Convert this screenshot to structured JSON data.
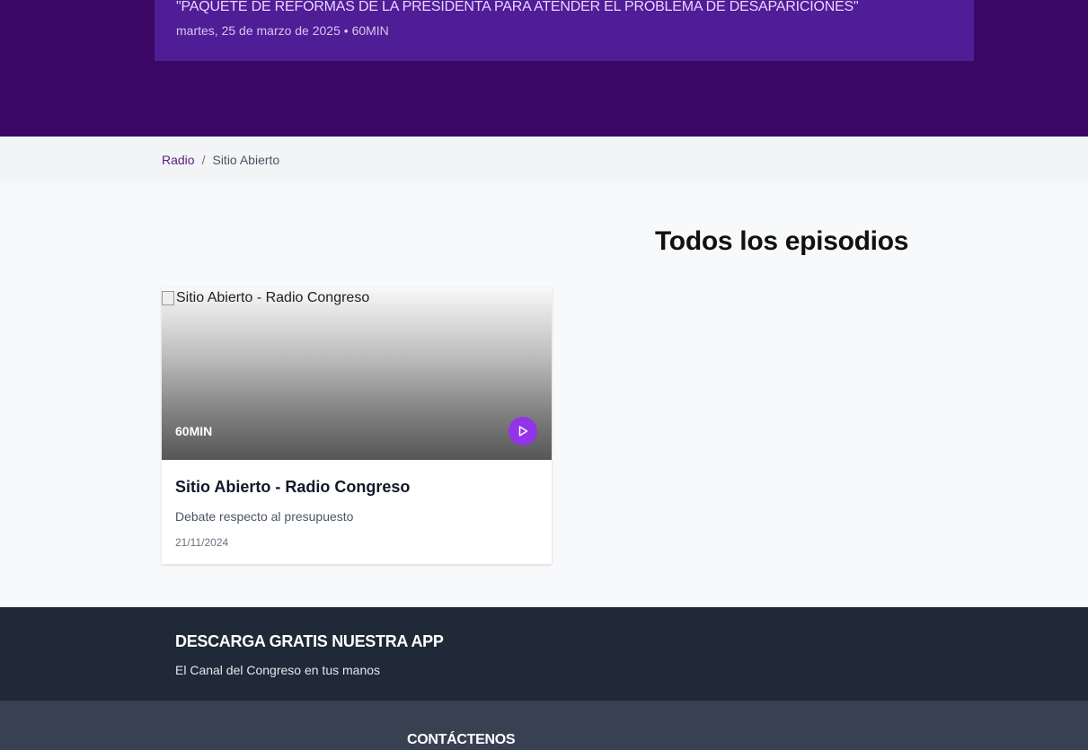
{
  "hero": {
    "title": "\"PAQUETE DE REFORMAS DE LA PRESIDENTA PARA ATENDER EL PROBLEMA DE DESAPARICIONES\"",
    "meta": "martes, 25 de marzo de 2025 • 60MIN"
  },
  "breadcrumb": {
    "items": [
      "Radio",
      "Sitio Abierto"
    ],
    "separator": "/"
  },
  "episodes": {
    "section_title": "Todos los episodios",
    "items": [
      {
        "image_alt": "Sitio Abierto - Radio Congreso",
        "duration": "60MIN",
        "title": "Sitio Abierto - Radio Congreso",
        "description": "Debate respecto al presupuesto",
        "date": "21/11/2024",
        "play_icon": "play-icon"
      }
    ]
  },
  "app_promo": {
    "title": "DESCARGA GRATIS NUESTRA APP",
    "subtitle": "El Canal del Congreso en tus manos"
  },
  "footer": {
    "contact_title": "CONTÁCTENOS"
  },
  "colors": {
    "hero_bg": "#3b0764",
    "hero_card": "#4f1d96",
    "accent": "#9333ea",
    "app_band": "#1f2937",
    "footer": "#374151"
  }
}
